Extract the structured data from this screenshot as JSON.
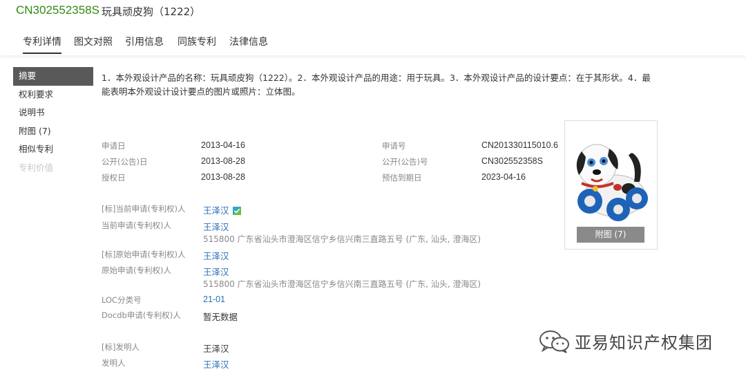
{
  "patent": {
    "number": "CN302552358S",
    "title": "玩具顽皮狗（1222）"
  },
  "tabs": [
    "专利详情",
    "图文对照",
    "引用信息",
    "同族专利",
    "法律信息"
  ],
  "sidebar": {
    "items": [
      {
        "label": "摘要",
        "state": "active"
      },
      {
        "label": "权利要求",
        "state": "normal"
      },
      {
        "label": "说明书",
        "state": "normal"
      },
      {
        "label": "附图 (7)",
        "state": "normal"
      },
      {
        "label": "相似专利",
        "state": "normal"
      },
      {
        "label": "专利价值",
        "state": "disabled"
      }
    ]
  },
  "abstract": "1．本外观设计产品的名称：玩具顽皮狗（1222）。2．本外观设计产品的用途：用于玩具。3．本外观设计产品的设计要点：在于其形状。4．最能表明本外观设计设计要点的图片或照片：立体图。",
  "dates": {
    "apply_date_label": "申请日",
    "apply_date": "2013-04-16",
    "pub_date_label": "公开(公告)日",
    "pub_date": "2013-08-28",
    "grant_date_label": "授权日",
    "grant_date": "2013-08-28",
    "apply_no_label": "申请号",
    "apply_no": "CN201330115010.6",
    "pub_no_label": "公开(公告)号",
    "pub_no": "CN302552358S",
    "expire_label": "预估到期日",
    "expire": "2023-04-16"
  },
  "applicants": {
    "std_current_label": "[标]当前申请(专利权)人",
    "std_current": "王泽汉",
    "current_label": "当前申请(专利权)人",
    "current": "王泽汉",
    "current_addr": "515800 广东省汕头市澄海区信宁乡信兴南三直路五号 (广东, 汕头, 澄海区)",
    "std_original_label": "[标]原始申请(专利权)人",
    "std_original": "王泽汉",
    "original_label": "原始申请(专利权)人",
    "original": "王泽汉",
    "original_addr": "515800 广东省汕头市澄海区信宁乡信兴南三直路五号 (广东, 汕头, 澄海区)",
    "loc_label": "LOC分类号",
    "loc": "21-01",
    "docdb_label": "Docdb申请(专利权)人",
    "docdb": "暂无数据",
    "std_inventor_label": "[标]发明人",
    "std_inventor": "王泽汉",
    "inventor_label": "发明人",
    "inventor": "王泽汉"
  },
  "figure": {
    "button_label": "附图 (7)"
  },
  "watermark": {
    "text": "亚易知识产权集团"
  },
  "colors": {
    "patent_number": "#2f8a12",
    "link": "#2a6fb8",
    "sidebar_active": "#595959",
    "verified": "#2aa9c9"
  }
}
